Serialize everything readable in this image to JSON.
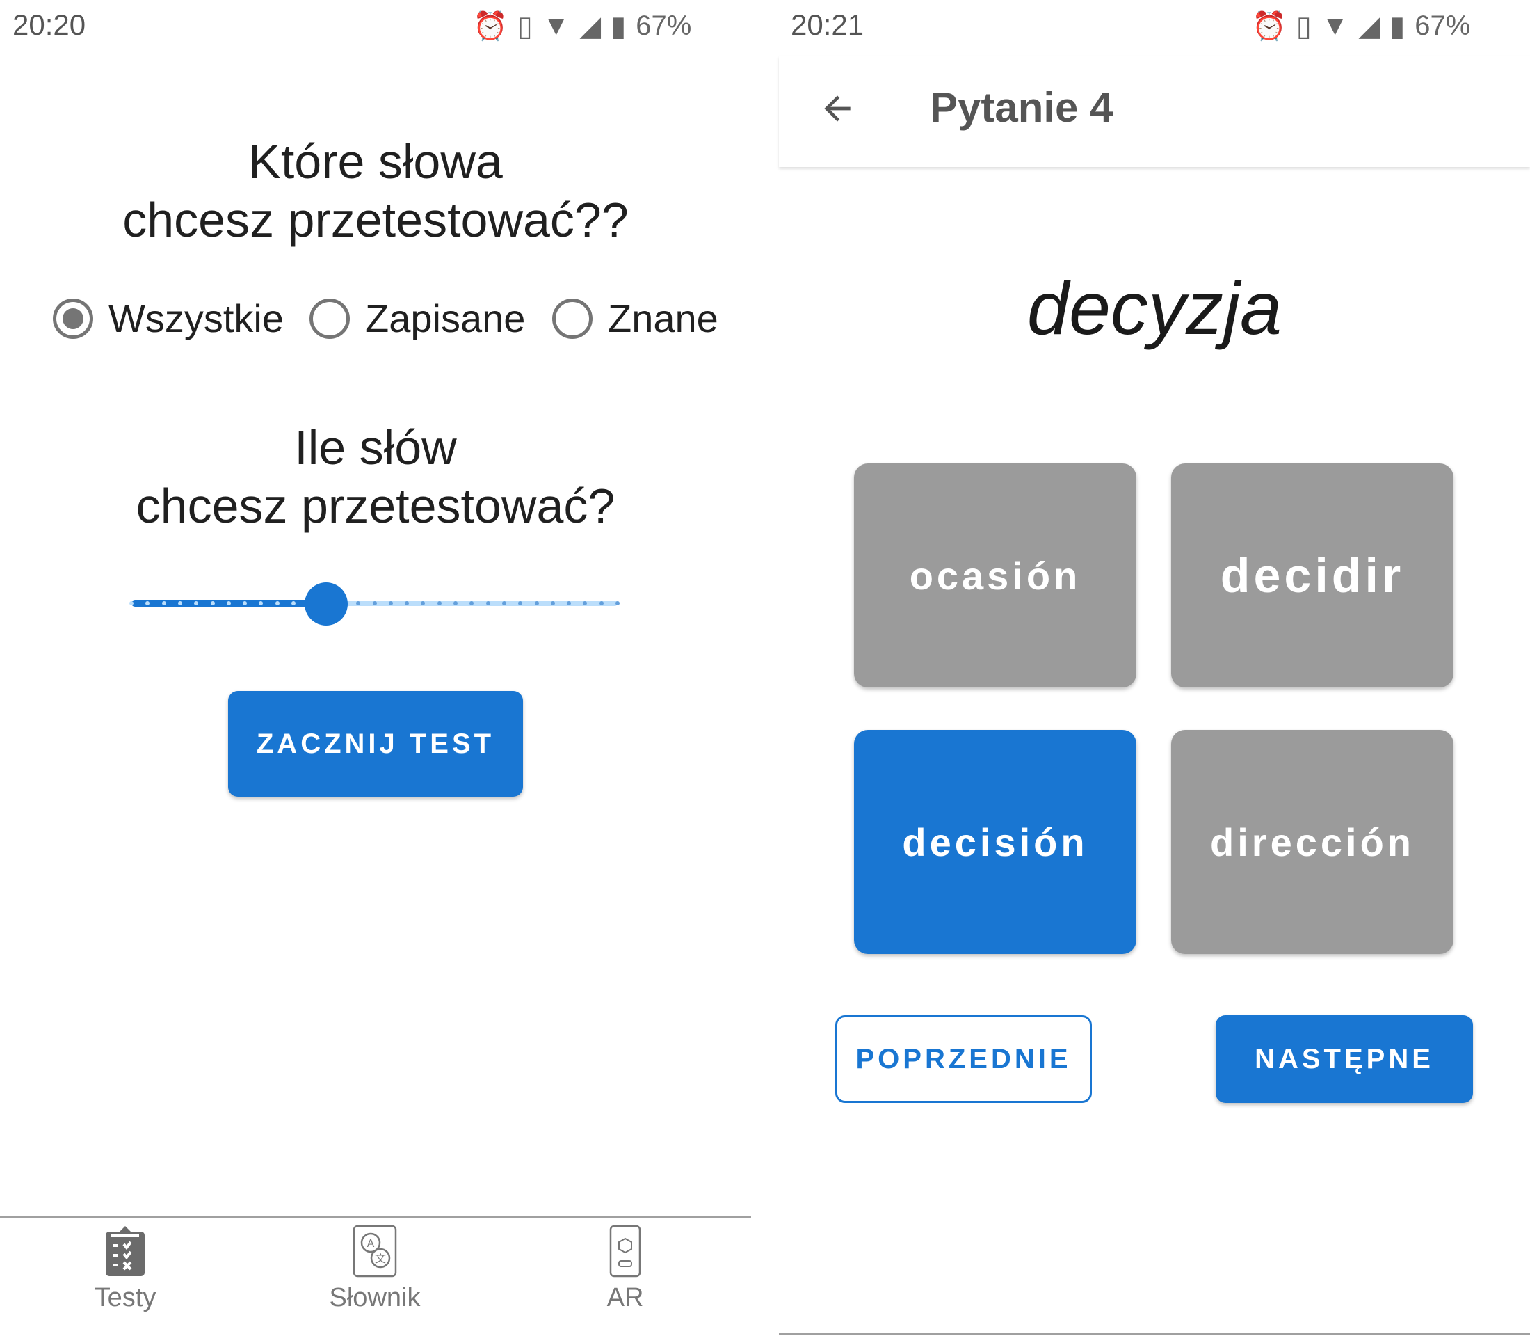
{
  "left": {
    "status": {
      "time": "20:20",
      "battery": "67%"
    },
    "question1": [
      "Które słowa",
      "chcesz przetestować??"
    ],
    "radios": [
      {
        "label": "Wszystkie",
        "selected": true
      },
      {
        "label": "Zapisane",
        "selected": false
      },
      {
        "label": "Znane",
        "selected": false
      }
    ],
    "question2": [
      "Ile słów",
      "chcesz przetestować?"
    ],
    "slider": {
      "fraction": 0.4,
      "color": "#1976d2"
    },
    "start_button": "ZACZNIJ TEST",
    "nav": [
      {
        "label": "Testy",
        "icon": "clipboard-checklist-icon"
      },
      {
        "label": "Słownik",
        "icon": "dictionary-translate-icon"
      },
      {
        "label": "AR",
        "icon": "phone-ar-cube-icon"
      }
    ]
  },
  "right": {
    "status": {
      "time": "20:21",
      "battery": "67%"
    },
    "toolbar": {
      "title": "Pytanie 4"
    },
    "word": "decyzja",
    "answers": [
      {
        "label": "ocasión",
        "selected": false
      },
      {
        "label": "decidir",
        "selected": false
      },
      {
        "label": "decisión",
        "selected": true
      },
      {
        "label": "dirección",
        "selected": false
      }
    ],
    "prev_button": "POPRZEDNIE",
    "next_button": "NASTĘPNE"
  },
  "colors": {
    "accent": "#1976d2",
    "card": "#9b9b9b"
  }
}
